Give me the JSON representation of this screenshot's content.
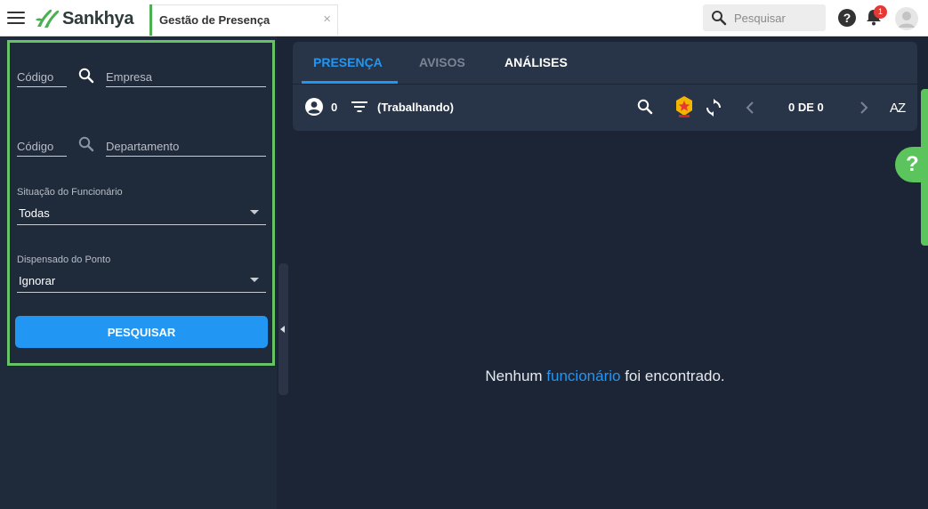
{
  "app": {
    "brand": "Sankhya",
    "tab_title": "Gestão de Presença",
    "close_glyph": "×"
  },
  "topbar": {
    "search_placeholder": "Pesquisar",
    "help_glyph": "?",
    "notification_count": "1"
  },
  "filters": {
    "empresa": {
      "code_placeholder": "Código",
      "name_placeholder": "Empresa"
    },
    "departamento": {
      "code_placeholder": "Código",
      "name_placeholder": "Departamento"
    },
    "situacao": {
      "label": "Situação do Funcionário",
      "value": "Todas"
    },
    "dispensado": {
      "label": "Dispensado do Ponto",
      "value": "Ignorar"
    },
    "search_button": "PESQUISAR"
  },
  "main": {
    "tabs": [
      {
        "label": "PRESENÇA",
        "active": true
      },
      {
        "label": "AVISOS",
        "active": false
      },
      {
        "label": "ANÁLISES",
        "active": false
      }
    ],
    "toolbar": {
      "count": "0",
      "filter_label": "(Trabalhando)",
      "pagination": "0 DE 0",
      "sort_glyph": "AZ"
    },
    "empty_message": {
      "before": "Nenhum ",
      "highlight": "funcionário",
      "after": " foi encontrado."
    },
    "help_glyph": "?"
  },
  "colors": {
    "accent": "#2196f3",
    "brand_green": "#4caf50",
    "highlight_border": "#66c466",
    "panel_bg": "#1f2a3b",
    "page_bg": "#1b2535"
  },
  "icons": [
    "hamburger-icon",
    "sankhya-logo-icon",
    "close-icon",
    "search-icon",
    "help-icon",
    "bell-icon",
    "avatar-icon",
    "chevron-down-icon",
    "collapse-left-icon",
    "user-circle-icon",
    "filter-icon",
    "badge-star-icon",
    "refresh-icon",
    "chevron-left-icon",
    "chevron-right-icon",
    "sort-az-icon"
  ]
}
